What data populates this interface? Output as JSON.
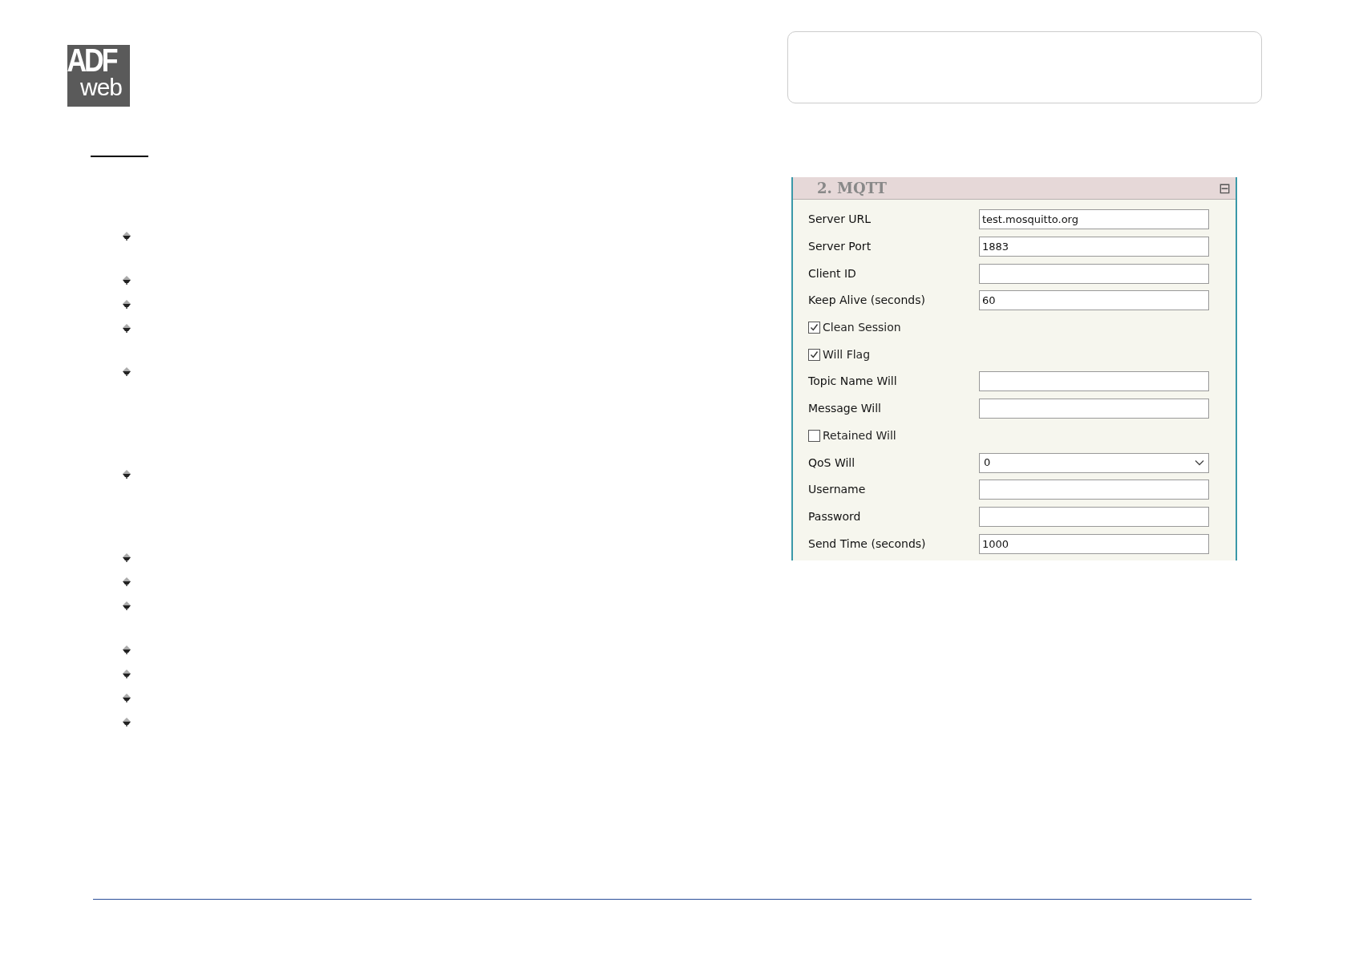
{
  "logo": {
    "top": "ADF",
    "bottom": "web"
  },
  "panel": {
    "title": "2. MQTT",
    "collapse_symbol": "⊟",
    "fields": [
      {
        "kind": "text",
        "label": "Server URL",
        "value": "test.mosquitto.org"
      },
      {
        "kind": "text",
        "label": "Server Port",
        "value": "1883"
      },
      {
        "kind": "text",
        "label": "Client ID"
      },
      {
        "kind": "text",
        "label": "Keep Alive (seconds)",
        "value": "60"
      },
      {
        "kind": "checkbox",
        "label": "Clean Session",
        "checked": true
      },
      {
        "kind": "checkbox",
        "label": "Will Flag",
        "checked": true
      },
      {
        "kind": "text",
        "label": "Topic Name Will"
      },
      {
        "kind": "text",
        "label": "Message Will"
      },
      {
        "kind": "checkbox",
        "label": "Retained Will",
        "checked": false
      },
      {
        "kind": "select",
        "label": "QoS Will",
        "value": "0"
      },
      {
        "kind": "text",
        "label": "Username"
      },
      {
        "kind": "text",
        "label": "Password"
      },
      {
        "kind": "text",
        "label": "Send Time (seconds)",
        "value": "1000"
      }
    ]
  }
}
